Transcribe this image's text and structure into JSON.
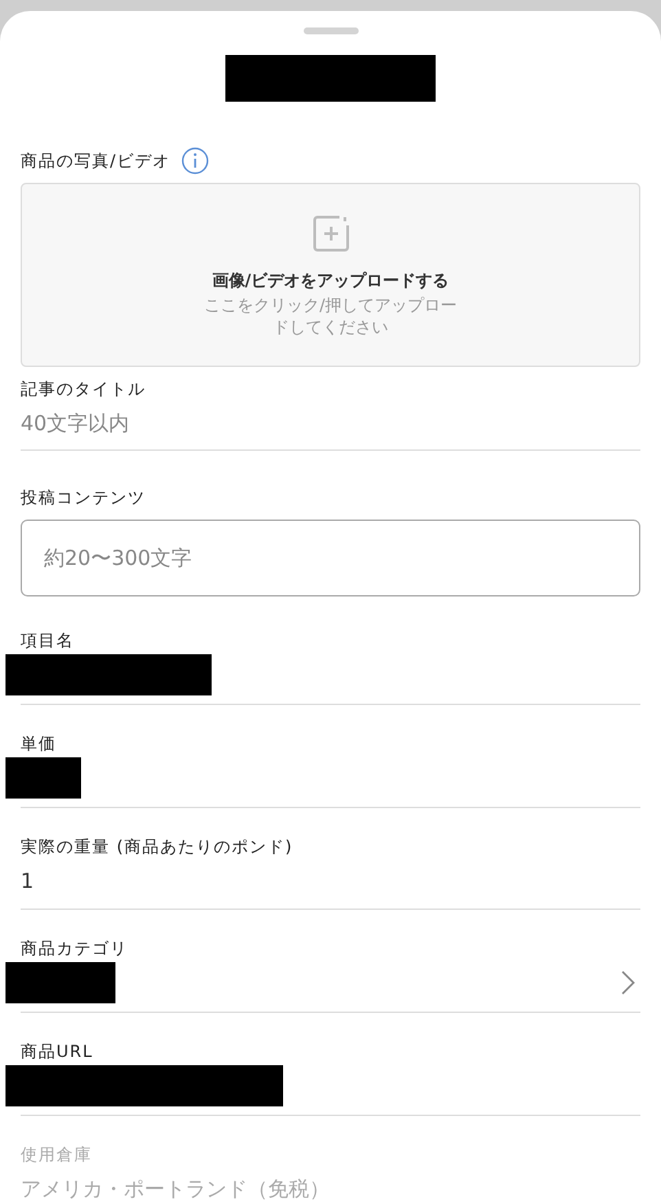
{
  "sheet": {
    "title_redacted": true
  },
  "media": {
    "label": "商品の写真/ビデオ",
    "upload_title": "画像/ビデオをアップロードする",
    "upload_hint": "ここをクリック/押してアップロードしてください"
  },
  "fields": [
    {
      "kind": "text",
      "label": "記事のタイトル",
      "placeholder": "40文字以内",
      "disabled": false
    },
    {
      "kind": "textarea",
      "label": "投稿コンテンツ",
      "placeholder": "約20〜300文字",
      "disabled": false
    },
    {
      "kind": "text",
      "label": "項目名",
      "redacted": true,
      "disabled": false
    },
    {
      "kind": "text",
      "label": "単価",
      "redacted": true,
      "disabled": false
    },
    {
      "kind": "text",
      "label": "実際の重量 (商品あたりのポンド)",
      "value": "1",
      "disabled": false
    },
    {
      "kind": "select",
      "label": "商品カテゴリ",
      "redacted": true,
      "disabled": false
    },
    {
      "kind": "text",
      "label": "商品URL",
      "redacted": true,
      "disabled": false
    },
    {
      "kind": "text",
      "label": "使用倉庫",
      "value": "アメリカ・ポートランド（免税）",
      "disabled": true
    }
  ]
}
